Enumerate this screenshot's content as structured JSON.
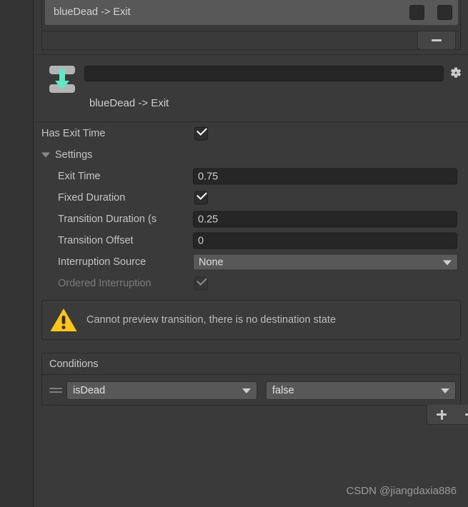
{
  "transition_list": {
    "selected_row_label": "blueDead -> Exit",
    "toggle_boxes": [
      "solo-toggle",
      "mute-toggle"
    ],
    "remove_button_label": "remove-transition"
  },
  "header": {
    "icon": "transition-icon",
    "name_field_value": "",
    "name_field_placeholder": "",
    "settings_icon": "gear-icon",
    "title": "blueDead -> Exit"
  },
  "properties": [
    {
      "label": "Has Exit Time",
      "type": "checkbox",
      "value": true,
      "indent": 0,
      "disabled": false,
      "name": "has-exit-time"
    },
    {
      "label": "Settings",
      "type": "foldout",
      "expanded": true,
      "indent": 0,
      "disabled": false,
      "name": "settings"
    },
    {
      "label": "Exit Time",
      "type": "text",
      "value": "0.75",
      "indent": 1,
      "disabled": false,
      "name": "exit-time"
    },
    {
      "label": "Fixed Duration",
      "type": "checkbox",
      "value": true,
      "indent": 1,
      "disabled": false,
      "name": "fixed-duration"
    },
    {
      "label": "Transition Duration (s",
      "type": "text",
      "value": "0.25",
      "indent": 1,
      "disabled": false,
      "clipped": true,
      "name": "transition-duration"
    },
    {
      "label": "Transition Offset",
      "type": "text",
      "value": "0",
      "indent": 1,
      "disabled": false,
      "name": "transition-offset"
    },
    {
      "label": "Interruption Source",
      "type": "dropdown",
      "value": "None",
      "indent": 1,
      "disabled": false,
      "name": "interruption-source"
    },
    {
      "label": "Ordered Interruption",
      "type": "checkbox",
      "value": true,
      "indent": 1,
      "disabled": true,
      "name": "ordered-interruption"
    }
  ],
  "warning": {
    "icon": "warning-triangle-icon",
    "message": "Cannot preview transition, there is no destination state",
    "color": "#FFC61A"
  },
  "conditions": {
    "header_label": "Conditions",
    "rows": [
      {
        "parameter": "isDead",
        "value": "false"
      }
    ],
    "add_button_label": "+",
    "remove_button_label": "-"
  },
  "watermark": "CSDN @jiangdaxia886",
  "colors": {
    "panel_bg": "#3a3a3a",
    "field_bg": "#262626",
    "dropdown_bg": "#585858",
    "accent_teal": "#5de8c2",
    "warning_yellow": "#FFC61A"
  }
}
